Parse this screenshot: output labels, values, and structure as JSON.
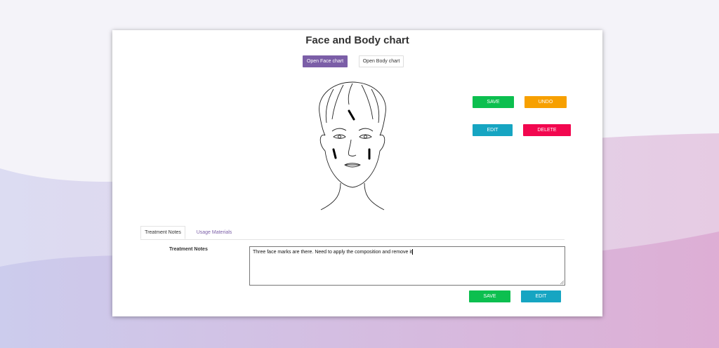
{
  "page": {
    "title": "Face and Body chart"
  },
  "chart_toggle": {
    "face_label": "Open Face chart",
    "body_label": "Open Body chart"
  },
  "chart_actions": {
    "save_label": "SAVE",
    "undo_label": "UNDO",
    "edit_label": "EDIT",
    "delete_label": "DELETE"
  },
  "tabs": [
    {
      "label": "Treatment Notes"
    },
    {
      "label": "Usage Materials"
    }
  ],
  "notes": {
    "label": "Treatment Notes",
    "value": "Three face marks are there. Need to apply the composition and remove it"
  },
  "notes_actions": {
    "save_label": "SAVE",
    "edit_label": "EDIT"
  },
  "colors": {
    "primary": "#7b5ea7",
    "save": "#0cbf4f",
    "undo": "#f7a000",
    "edit": "#16a5c2",
    "delete": "#f2074f"
  },
  "face_marks_count": 3
}
